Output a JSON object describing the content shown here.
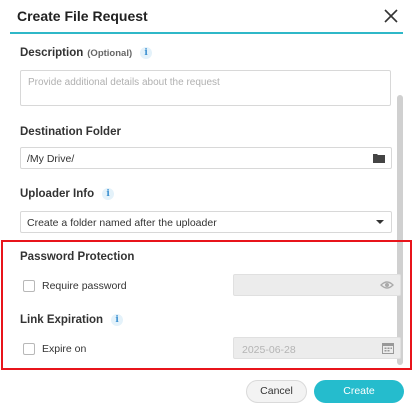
{
  "dialog": {
    "title": "Create File Request",
    "close_icon": "close-icon",
    "accent_color": "#2fb8c8"
  },
  "description": {
    "label": "Description",
    "optional": "(Optional)",
    "placeholder": "Provide additional details about the request",
    "value": ""
  },
  "destination": {
    "label": "Destination Folder",
    "value": "/My Drive/",
    "icon": "folder-icon"
  },
  "uploader": {
    "label": "Uploader Info",
    "selected": "Create a folder named after the uploader"
  },
  "password": {
    "section_label": "Password Protection",
    "checkbox_label": "Require password",
    "checked": false,
    "input_value": "",
    "icon": "eye-icon"
  },
  "expiration": {
    "section_label": "Link Expiration",
    "checkbox_label": "Expire on",
    "checked": false,
    "date_placeholder": "2025-06-28",
    "icon": "calendar-icon"
  },
  "footer": {
    "cancel_label": "Cancel",
    "create_label": "Create",
    "create_color": "#25bccd"
  },
  "annotation": {
    "highlight_color": "#e8141b"
  }
}
